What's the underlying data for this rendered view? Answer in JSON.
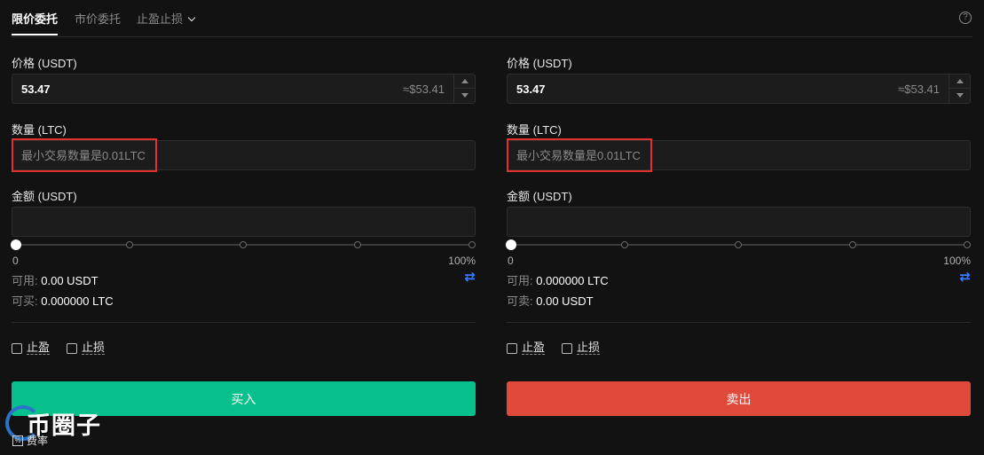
{
  "tabs": {
    "items": [
      {
        "label": "限价委托",
        "active": true
      },
      {
        "label": "市价委托",
        "active": false
      },
      {
        "label": "止盈止损",
        "active": false
      }
    ]
  },
  "buy": {
    "price_label": "价格 (USDT)",
    "price_value": "53.47",
    "price_approx": "≈$53.41",
    "qty_label": "数量 (LTC)",
    "qty_placeholder": "最小交易数量是0.01LTC",
    "amount_label": "金额 (USDT)",
    "amount_value": "",
    "slider_percent": 0,
    "slider_min_label": "0",
    "slider_max_label": "100%",
    "available_label": "可用:",
    "available_value": "0.00 USDT",
    "can_label": "可买:",
    "can_value": "0.000000 LTC",
    "take_profit_label": "止盈",
    "stop_loss_label": "止损",
    "action_label": "买入"
  },
  "sell": {
    "price_label": "价格 (USDT)",
    "price_value": "53.47",
    "price_approx": "≈$53.41",
    "qty_label": "数量 (LTC)",
    "qty_placeholder": "最小交易数量是0.01LTC",
    "amount_label": "金额 (USDT)",
    "amount_value": "",
    "slider_percent": 0,
    "slider_min_label": "0",
    "slider_max_label": "100%",
    "available_label": "可用:",
    "available_value": "0.000000 LTC",
    "can_label": "可卖:",
    "can_value": "0.00 USDT",
    "take_profit_label": "止盈",
    "stop_loss_label": "止损",
    "action_label": "卖出"
  },
  "footer": {
    "fee_label": "费率",
    "watermark_text": "币圈子"
  },
  "colors": {
    "buy": "#07c08b",
    "sell": "#e04a3b",
    "highlight": "#e03030",
    "swap": "#3a7bff"
  },
  "icons": [
    "help-icon",
    "chevron-down-icon",
    "swap-icon",
    "fee-icon"
  ]
}
